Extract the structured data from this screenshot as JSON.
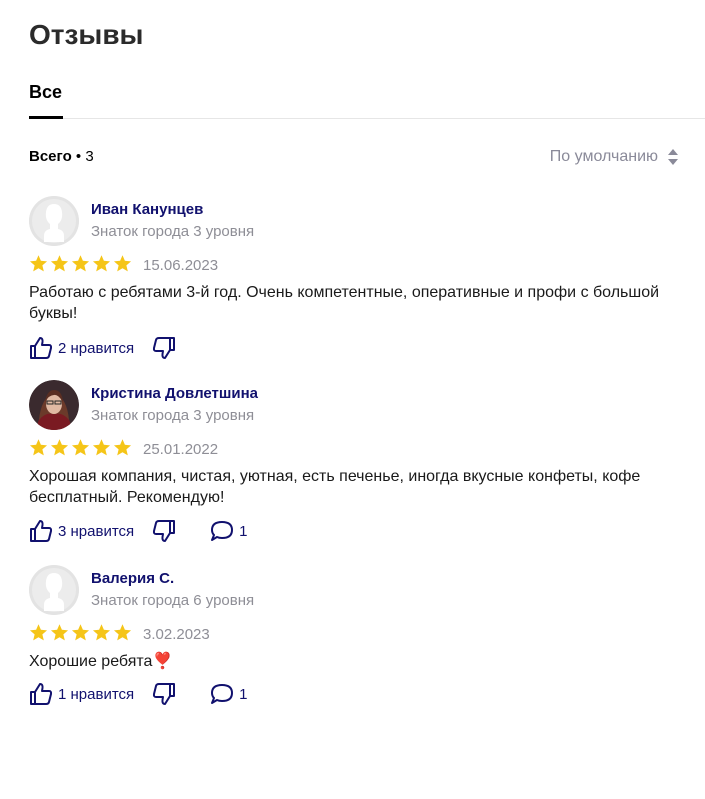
{
  "header": {
    "title": "Отзывы"
  },
  "tabs": [
    {
      "label": "Все",
      "active": true
    }
  ],
  "summary": {
    "label": "Всего",
    "separator": "•",
    "count": "3"
  },
  "sort": {
    "label": "По умолчанию"
  },
  "colors": {
    "star": "#f5c518",
    "link": "#11116e",
    "muted": "#8e8e96"
  },
  "reviews": [
    {
      "name": "Иван Канунцев",
      "level": "Знаток города 3 уровня",
      "rating": 5,
      "date": "15.06.2023",
      "text": "Работаю с ребятами 3-й год. Очень компетентные, оперативные и профи с большой буквы!",
      "likes": "2 нравится",
      "comments": "",
      "avatar": "placeholder"
    },
    {
      "name": "Кристина Довлетшина",
      "level": "Знаток города 3 уровня",
      "rating": 5,
      "date": "25.01.2022",
      "text": "Хорошая компания, чистая, уютная, есть печенье, иногда вкусные конфеты, кофе бесплатный. Рекомендую!",
      "likes": "3 нравится",
      "comments": "1",
      "avatar": "photo"
    },
    {
      "name": "Валерия С.",
      "level": "Знаток города 6 уровня",
      "rating": 5,
      "date": "3.02.2023",
      "text": "Хорошие ребята❣️",
      "likes": "1 нравится",
      "comments": "1",
      "avatar": "placeholder"
    }
  ]
}
